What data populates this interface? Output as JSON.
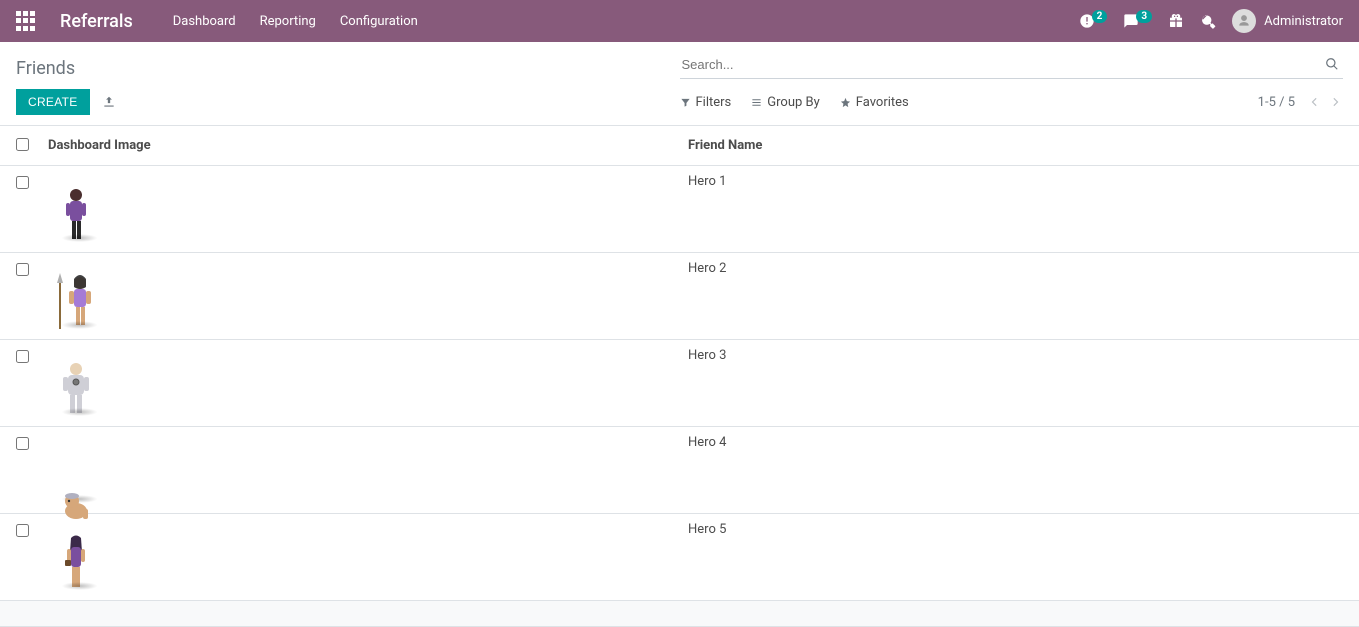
{
  "navbar": {
    "brand": "Referrals",
    "links": [
      "Dashboard",
      "Reporting",
      "Configuration"
    ],
    "clock_badge": "2",
    "chat_badge": "3",
    "user_name": "Administrator"
  },
  "controlpanel": {
    "breadcrumb": "Friends",
    "search_placeholder": "Search...",
    "create_label": "CREATE",
    "filters_label": "Filters",
    "groupby_label": "Group By",
    "favorites_label": "Favorites",
    "pager": "1-5 / 5"
  },
  "table": {
    "col_image": "Dashboard Image",
    "col_name": "Friend Name",
    "rows": [
      {
        "name": "Hero 1"
      },
      {
        "name": "Hero 2"
      },
      {
        "name": "Hero 3"
      },
      {
        "name": "Hero 4"
      },
      {
        "name": "Hero 5"
      }
    ]
  }
}
